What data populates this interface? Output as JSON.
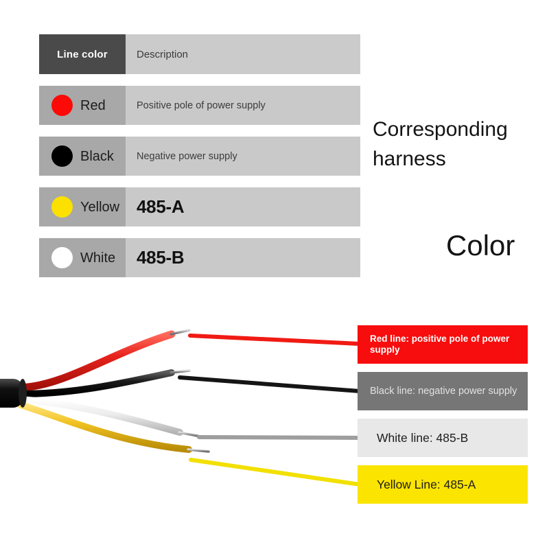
{
  "table": {
    "header": {
      "color_column": "Line color",
      "description_column": "Description"
    },
    "rows": [
      {
        "color_name": "Red",
        "swatch_hex": "#fb0a07",
        "description": "Positive pole of power supply",
        "emphasis": "small"
      },
      {
        "color_name": "Black",
        "swatch_hex": "#000000",
        "description": "Negative power supply",
        "emphasis": "small"
      },
      {
        "color_name": "Yellow",
        "swatch_hex": "#fbe000",
        "description": "485-A",
        "emphasis": "big"
      },
      {
        "color_name": "White",
        "swatch_hex": "#ffffff",
        "description": "485-B",
        "emphasis": "big"
      }
    ]
  },
  "headings": {
    "harness": "Corresponding harness",
    "color": "Color"
  },
  "callouts": [
    {
      "key": "red",
      "text": "Red line: positive pole of power supply",
      "box_hex": "#f70d0d",
      "text_hex": "#ffffff"
    },
    {
      "key": "black",
      "text": "Black line: negative power supply",
      "box_hex": "#767676",
      "text_hex": "#e2e2e2"
    },
    {
      "key": "white",
      "text": "White line: 485-B",
      "box_hex": "#e8e8e8",
      "text_hex": "#1d1d1d"
    },
    {
      "key": "yellow",
      "text": "Yellow Line: 485-A",
      "box_hex": "#fbe400",
      "text_hex": "#1d1d1d"
    }
  ],
  "wire_diagram": {
    "sheath_hex": "#141414",
    "wires": [
      {
        "name": "red-wire",
        "hex": "#e8231c"
      },
      {
        "name": "black-wire",
        "hex": "#1a1a1a"
      },
      {
        "name": "white-wire",
        "hex": "#f2f2f2"
      },
      {
        "name": "yellow-wire",
        "hex": "#f0c222"
      }
    ],
    "leader_lines": [
      {
        "name": "red-leader-line",
        "hex": "#f01b14"
      },
      {
        "name": "black-leader-line",
        "hex": "#151515"
      },
      {
        "name": "white-leader-line",
        "hex": "#9e9e9e"
      },
      {
        "name": "yellow-leader-line",
        "hex": "#f2e000"
      }
    ]
  }
}
